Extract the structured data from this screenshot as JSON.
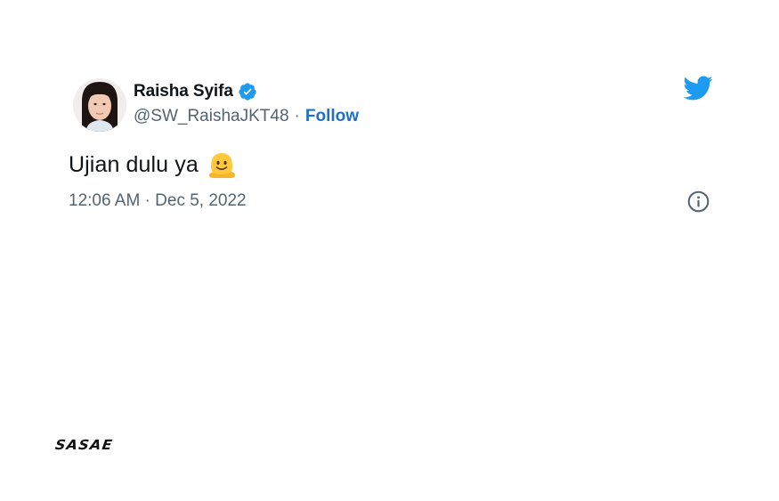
{
  "author": {
    "name": "Raisha Syifa",
    "handle": "@SW_RaishaJKT48",
    "separator": "·",
    "follow_label": "Follow",
    "verified": true
  },
  "tweet": {
    "text": "Ujian dulu ya",
    "emoji": "melting-face-emoji",
    "timestamp": "12:06 AM · Dec 5, 2022"
  },
  "icons": {
    "brand": "twitter-bird-icon",
    "verified": "verified-badge-icon",
    "info": "info-icon"
  },
  "watermark": {
    "text": "SASAE"
  },
  "colors": {
    "text_primary": "#0f1419",
    "text_secondary": "#536471",
    "link": "#1d72c8",
    "twitter_blue": "#1d9bf0",
    "emoji_yellow": "#ffc83d"
  }
}
